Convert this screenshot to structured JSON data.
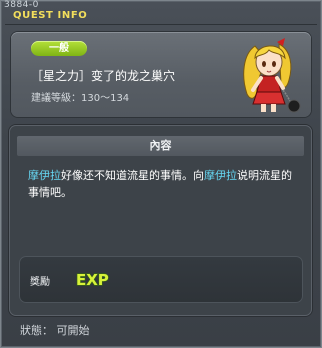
{
  "window": {
    "quest_id": "3884-0",
    "title": "QUEST INFO"
  },
  "header": {
    "badge": "一般",
    "quest_name": "［星之力］变了的龙之巢穴",
    "level_text": "建議等級：130～134"
  },
  "content": {
    "section_title": "內容",
    "desc": {
      "part1": "摩伊拉",
      "part2": "好像还不知道流星的事情。向",
      "part3": "摩伊拉",
      "part4": "说明流星的事情吧。"
    },
    "reward_label": "獎勵",
    "reward_icon": "exp-icon"
  },
  "footer": {
    "status": "狀態： 可開始"
  },
  "colors": {
    "title": "#f3df5c",
    "badge": "#8cc21e",
    "highlight": "#66d8f4"
  }
}
